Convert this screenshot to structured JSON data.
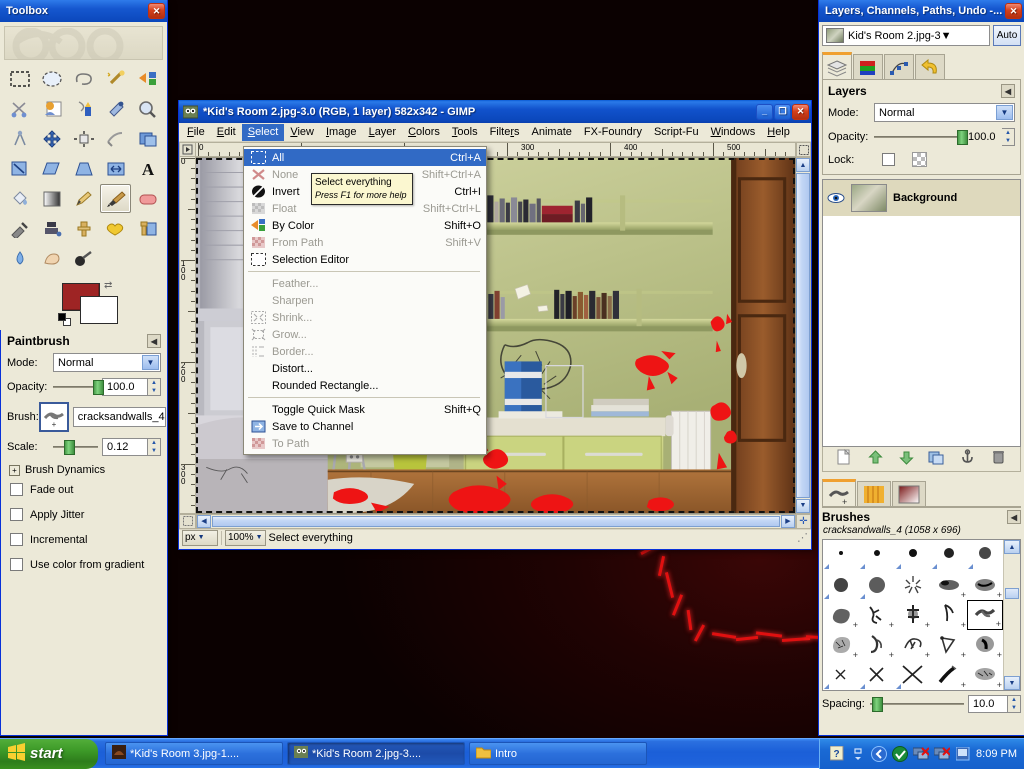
{
  "toolbox": {
    "title": "Toolbox",
    "close_label": "✕",
    "tools": [
      {
        "name": "rect-select-tool"
      },
      {
        "name": "ellipse-select-tool"
      },
      {
        "name": "free-select-tool"
      },
      {
        "name": "fuzzy-select-tool"
      },
      {
        "name": "select-by-color-tool"
      },
      {
        "name": "scissors-select-tool"
      },
      {
        "name": "foreground-select-tool"
      },
      {
        "name": "paths-tool"
      },
      {
        "name": "color-picker-tool"
      },
      {
        "name": "zoom-tool"
      },
      {
        "name": "measure-tool"
      },
      {
        "name": "move-tool"
      },
      {
        "name": "align-tool"
      },
      {
        "name": "crop-tool"
      },
      {
        "name": "rotate-tool"
      },
      {
        "name": "scale-tool"
      },
      {
        "name": "shear-tool"
      },
      {
        "name": "perspective-tool"
      },
      {
        "name": "flip-tool"
      },
      {
        "name": "text-tool"
      },
      {
        "name": "bucket-fill-tool"
      },
      {
        "name": "gradient-tool"
      },
      {
        "name": "pencil-tool"
      },
      {
        "name": "paintbrush-tool"
      },
      {
        "name": "eraser-tool"
      },
      {
        "name": "airbrush-tool"
      },
      {
        "name": "ink-tool"
      },
      {
        "name": "clone-tool"
      },
      {
        "name": "heal-tool"
      },
      {
        "name": "perspective-clone-tool"
      },
      {
        "name": "blur-sharpen-tool"
      },
      {
        "name": "smudge-tool"
      },
      {
        "name": "dodge-burn-tool"
      }
    ],
    "selected_tool_index": 23,
    "foreground_color": "#9e2424",
    "background_color": "#ffffff"
  },
  "tool_options": {
    "title": "Paintbrush",
    "mode_label": "Mode:",
    "mode_value": "Normal",
    "opacity_label": "Opacity:",
    "opacity_value": "100.0",
    "brush_label": "Brush:",
    "brush_value": "cracksandwalls_4",
    "scale_label": "Scale:",
    "scale_value": "0.12",
    "brush_dynamics_label": "Brush Dynamics",
    "checkboxes": [
      {
        "label": "Fade out",
        "checked": false
      },
      {
        "label": "Apply Jitter",
        "checked": false
      },
      {
        "label": "Incremental",
        "checked": false
      },
      {
        "label": "Use color from gradient",
        "checked": false
      }
    ]
  },
  "image_window": {
    "title": "*Kid's Room 2.jpg-3.0 (RGB, 1 layer) 582x342 - GIMP",
    "minimize_label": "_",
    "maximize_label": "❐",
    "close_label": "✕",
    "menus": [
      {
        "label": "File",
        "mnemonic": "F"
      },
      {
        "label": "Edit",
        "mnemonic": "E"
      },
      {
        "label": "Select",
        "mnemonic": "S"
      },
      {
        "label": "View",
        "mnemonic": "V"
      },
      {
        "label": "Image",
        "mnemonic": "I"
      },
      {
        "label": "Layer",
        "mnemonic": "L"
      },
      {
        "label": "Colors",
        "mnemonic": "C"
      },
      {
        "label": "Tools",
        "mnemonic": "T"
      },
      {
        "label": "Filters",
        "mnemonic": "R"
      },
      {
        "label": "Animate",
        "mnemonic": "A"
      },
      {
        "label": "FX-Foundry",
        "mnemonic": "X"
      },
      {
        "label": "Script-Fu",
        "mnemonic": "S"
      },
      {
        "label": "Windows",
        "mnemonic": "W"
      },
      {
        "label": "Help",
        "mnemonic": "H"
      }
    ],
    "open_menu_index": 2,
    "hruler_labels": [
      "0",
      "300",
      "400",
      "500"
    ],
    "vruler_labels": [
      "0",
      "100",
      "200",
      "300"
    ],
    "statusbar": {
      "unit": "px",
      "zoom": "100%",
      "message": "Select everything"
    }
  },
  "select_menu": {
    "items": [
      {
        "label": "All",
        "accel": "Ctrl+A",
        "icon": "select-all-icon",
        "enabled": true,
        "highlighted": true
      },
      {
        "label": "None",
        "accel": "Shift+Ctrl+A",
        "icon": "select-none-icon",
        "enabled": false,
        "highlighted": false
      },
      {
        "label": "Invert",
        "accel": "Ctrl+I",
        "icon": "select-invert-icon",
        "enabled": true,
        "highlighted": false
      },
      {
        "label": "Float",
        "accel": "Shift+Ctrl+L",
        "icon": "select-float-icon",
        "enabled": false,
        "highlighted": false
      },
      {
        "label": "By Color",
        "accel": "Shift+O",
        "icon": "select-by-color-icon",
        "enabled": true,
        "highlighted": false
      },
      {
        "label": "From Path",
        "accel": "Shift+V",
        "icon": "select-from-path-icon",
        "enabled": false,
        "highlighted": false
      },
      {
        "label": "Selection Editor",
        "accel": "",
        "icon": "selection-editor-icon",
        "enabled": true,
        "highlighted": false
      },
      {
        "separator": true
      },
      {
        "label": "Feather...",
        "accel": "",
        "icon": "",
        "enabled": false,
        "highlighted": false
      },
      {
        "label": "Sharpen",
        "accel": "",
        "icon": "",
        "enabled": false,
        "highlighted": false
      },
      {
        "label": "Shrink...",
        "accel": "",
        "icon": "shrink-icon",
        "enabled": false,
        "highlighted": false
      },
      {
        "label": "Grow...",
        "accel": "",
        "icon": "grow-icon",
        "enabled": false,
        "highlighted": false
      },
      {
        "label": "Border...",
        "accel": "",
        "icon": "border-icon",
        "enabled": false,
        "highlighted": false
      },
      {
        "label": "Distort...",
        "accel": "",
        "icon": "",
        "enabled": true,
        "highlighted": false
      },
      {
        "label": "Rounded Rectangle...",
        "accel": "",
        "icon": "",
        "enabled": true,
        "highlighted": false
      },
      {
        "separator": true
      },
      {
        "label": "Toggle Quick Mask",
        "accel": "Shift+Q",
        "icon": "",
        "enabled": true,
        "highlighted": false
      },
      {
        "label": "Save to Channel",
        "accel": "",
        "icon": "save-to-channel-icon",
        "enabled": true,
        "highlighted": false
      },
      {
        "label": "To Path",
        "accel": "",
        "icon": "to-path-icon",
        "enabled": false,
        "highlighted": false
      }
    ]
  },
  "tooltip": {
    "text": "Select everything",
    "hint": "Press F1 for more help"
  },
  "layers_dock": {
    "title": "Layers, Channels, Paths, Undo -...",
    "close_label": "✕",
    "image_name": "Kid's Room 2.jpg-3",
    "auto_label": "Auto",
    "tabs": [
      {
        "name": "layers-tab",
        "active": true
      },
      {
        "name": "channels-tab",
        "active": false
      },
      {
        "name": "paths-tab",
        "active": false
      },
      {
        "name": "undo-tab",
        "active": false
      }
    ],
    "panel_title": "Layers",
    "mode_label": "Mode:",
    "mode_value": "Normal",
    "opacity_label": "Opacity:",
    "opacity_value": "100.0",
    "lock_label": "Lock:",
    "layers": [
      {
        "name": "Background",
        "visible": true
      }
    ],
    "buttons": [
      {
        "name": "new-layer-button"
      },
      {
        "name": "raise-layer-button"
      },
      {
        "name": "lower-layer-button"
      },
      {
        "name": "duplicate-layer-button"
      },
      {
        "name": "anchor-layer-button"
      },
      {
        "name": "delete-layer-button"
      }
    ]
  },
  "brushes_dock": {
    "tabs": [
      {
        "name": "brushes-tab",
        "active": true
      },
      {
        "name": "patterns-tab",
        "active": false
      },
      {
        "name": "gradients-tab",
        "active": false
      }
    ],
    "panel_title": "Brushes",
    "selected_brush": "cracksandwalls_4 (1058 x 696)",
    "spacing_label": "Spacing:",
    "spacing_value": "10.0"
  },
  "taskbar": {
    "start_label": "start",
    "tasks": [
      {
        "label": "*Kid's Room 3.jpg-1....",
        "active": false
      },
      {
        "label": "*Kid's Room 2.jpg-3....",
        "active": true
      },
      {
        "label": "Intro",
        "active": false,
        "icon": "folder-icon"
      }
    ],
    "tray_icons": [
      "help-icon",
      "network-icon",
      "back-icon",
      "antivirus-icon",
      "network-disconnected-icon",
      "network-disconnected-2-icon",
      "display-icon"
    ],
    "clock": "8:09 PM"
  }
}
